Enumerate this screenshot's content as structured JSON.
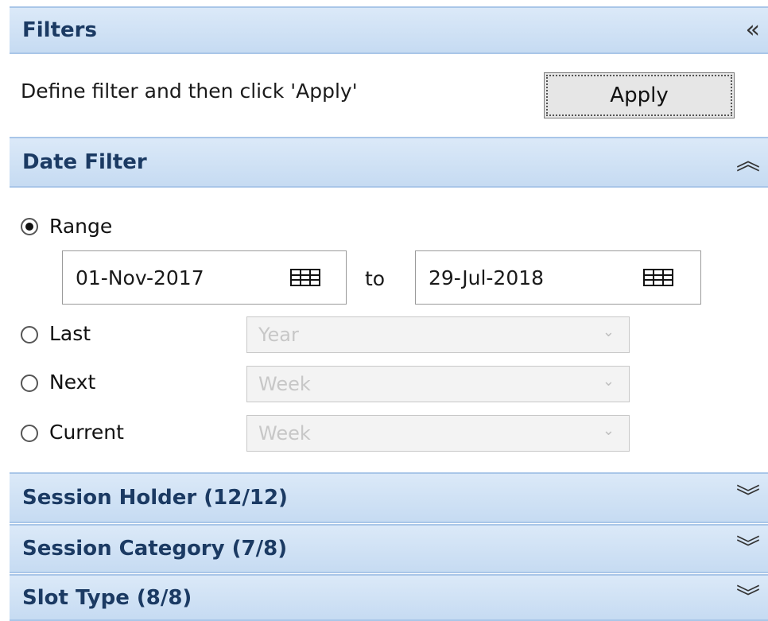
{
  "filters": {
    "title": "Filters",
    "collapse_glyph": "«",
    "instructions": "Define filter and then click 'Apply'",
    "apply_label": "Apply"
  },
  "date_filter": {
    "title": "Date Filter",
    "toggle_glyph": "︽",
    "options": [
      {
        "label": "Range",
        "selected": true
      },
      {
        "label": "Last",
        "selected": false,
        "select_value": "Year"
      },
      {
        "label": "Next",
        "selected": false,
        "select_value": "Week"
      },
      {
        "label": "Current",
        "selected": false,
        "select_value": "Week"
      }
    ],
    "range": {
      "from": "01-Nov-2017",
      "to_label": "to",
      "to": "29-Jul-2018"
    },
    "select_chevron": "⌄"
  },
  "sections": [
    {
      "title": "Session Holder (12/12)",
      "toggle_glyph": "︾"
    },
    {
      "title": "Session Category (7/8)",
      "toggle_glyph": "︾"
    },
    {
      "title": "Slot Type (8/8)",
      "toggle_glyph": "︾"
    }
  ],
  "colors": {
    "header_bg": "#c6dbf2",
    "header_border": "#a9c6e8",
    "header_text": "#1b3a63",
    "disabled_text": "#c7c7c7"
  }
}
